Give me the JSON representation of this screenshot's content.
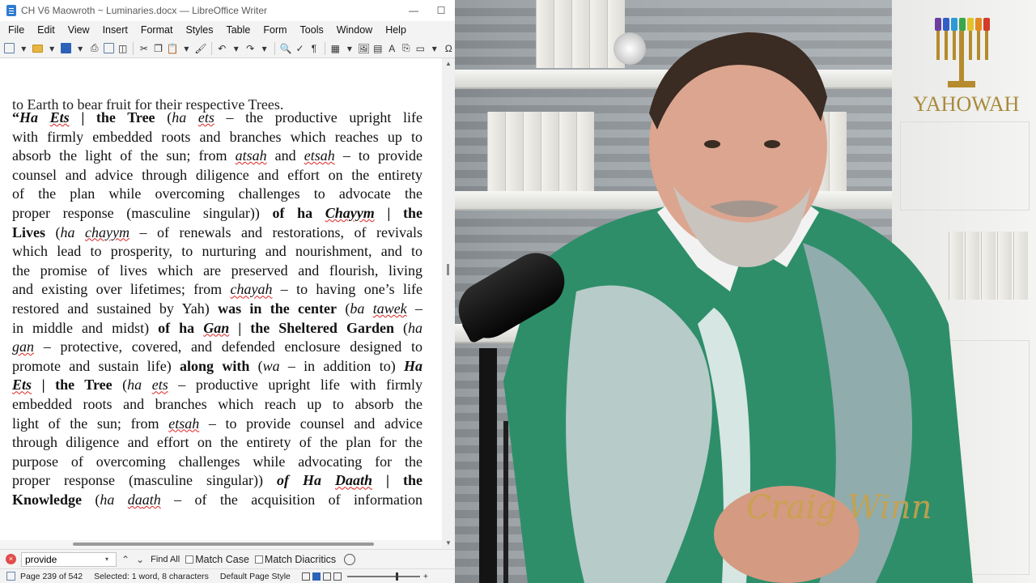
{
  "window": {
    "title": "CH V6 Maowroth ~ Luminaries.docx — LibreOffice Writer",
    "minimize": "—",
    "maximize": "☐"
  },
  "menu": [
    "File",
    "Edit",
    "View",
    "Insert",
    "Format",
    "Styles",
    "Table",
    "Form",
    "Tools",
    "Window",
    "Help"
  ],
  "document": {
    "cut_line": "to Earth to bear fruit for their respective Trees.",
    "lines": [
      [
        "“",
        "Ha ",
        "Ets",
        " | the Tree",
        " (",
        "ha ",
        "ets",
        " – the productive upright life"
      ],
      [
        "with firmly embedded roots and branches which reaches up to"
      ],
      [
        "absorb the light of the sun; from ",
        "atsah",
        " and ",
        "etsah",
        " – to provide"
      ],
      [
        "counsel and advice through diligence and effort on the entirety"
      ],
      [
        "of the plan while overcoming challenges to advocate the"
      ],
      [
        "proper response (masculine singular)) ",
        "of ha ",
        "Chayym",
        " | the"
      ],
      [
        "Lives",
        " (",
        "ha ",
        "chayym",
        " – of renewals and restorations, of revivals"
      ],
      [
        "which lead to prosperity, to nurturing and nourishment, and to"
      ],
      [
        "the promise of lives which are preserved and flourish, living"
      ],
      [
        "and existing over lifetimes; from ",
        "chayah",
        " – to having one’s life"
      ],
      [
        "restored and sustained by Yah) ",
        "was in the center",
        " (",
        "ba ",
        "tawek",
        " –"
      ],
      [
        "in middle and midst) ",
        "of ha ",
        "Gan",
        " | the Sheltered Garden",
        " (",
        "ha"
      ],
      [
        "gan",
        " – protective, covered, and defended enclosure designed to"
      ],
      [
        "promote and sustain life) ",
        "along with",
        " (",
        "wa",
        " – in addition to) ",
        "Ha"
      ],
      [
        "Ets",
        " | the Tree",
        " (",
        "ha ",
        "ets",
        " – productive upright life with firmly"
      ],
      [
        "embedded roots and branches which reach up to absorb the"
      ],
      [
        "light of the sun; from ",
        "etsah",
        " – to provide counsel and advice"
      ],
      [
        "through diligence and effort on the entirety of the plan for the"
      ],
      [
        "purpose of overcoming challenges while advocating for the"
      ],
      [
        "proper response (masculine singular)) ",
        "of Ha ",
        "Da",
        "ath",
        " | the"
      ],
      [
        "Knowledge",
        " (",
        "ha ",
        "da",
        "ath",
        " – of the acquisition of information"
      ]
    ],
    "page_number": "239"
  },
  "find": {
    "value": "provide",
    "find_all": "Find All",
    "match_case": "Match Case",
    "match_diacritics": "Match Diacritics"
  },
  "status": {
    "page": "Page 239 of 542",
    "selected": "Selected: 1 word, 8 characters",
    "page_style": "Default Page Style",
    "zoom_plus": "+"
  },
  "video": {
    "logo_text": "YAHOWAH",
    "signature": "Craig Winn",
    "menorah_colors": [
      "#6b3fa0",
      "#2f5fc4",
      "#2c9ad6",
      "#3aa64a",
      "#e0c32a",
      "#e58a22",
      "#d43a2a"
    ]
  }
}
